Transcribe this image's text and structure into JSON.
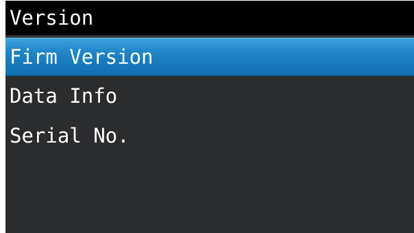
{
  "header": {
    "title": "Version"
  },
  "menu": {
    "items": [
      {
        "label": "Firm Version",
        "selected": true
      },
      {
        "label": "Data Info",
        "selected": false
      },
      {
        "label": "Serial No.",
        "selected": false
      }
    ]
  },
  "colors": {
    "screen_background": "#2b2c2e",
    "title_background": "#000000",
    "selection_highlight": "#1f86c9",
    "text": "#ffffff"
  }
}
